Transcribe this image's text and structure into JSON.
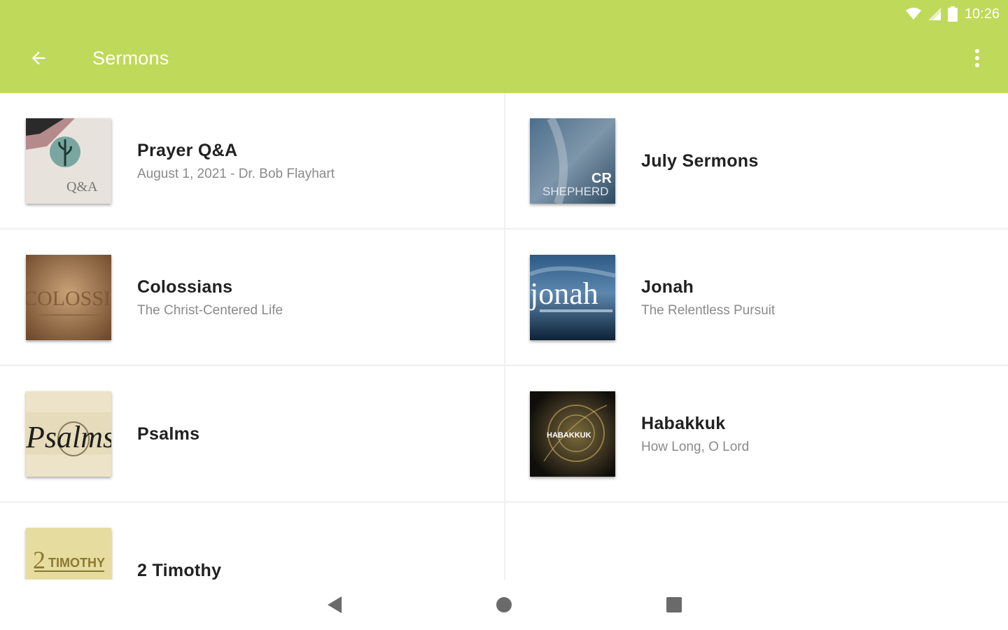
{
  "status_bar": {
    "time": "10:26",
    "icons": [
      "wifi-icon",
      "signal-icon",
      "battery-icon"
    ]
  },
  "app_bar": {
    "title": "Sermons",
    "back_icon": "arrow-left-icon",
    "more_icon": "more-vertical-icon",
    "color": "#bfd95a"
  },
  "series": [
    {
      "title": "Prayer Q&A",
      "subtitle": "August 1, 2021 - Dr. Bob Flayhart",
      "thumb_text": "Q&A"
    },
    {
      "title": "July Sermons",
      "subtitle": "",
      "thumb_text": "CR",
      "thumb_text2": "SHEPHERD"
    },
    {
      "title": "Colossians",
      "subtitle": "The Christ-Centered Life",
      "thumb_text": "COLOSSIANS"
    },
    {
      "title": "Jonah",
      "subtitle": "The Relentless Pursuit",
      "thumb_text": "jonah"
    },
    {
      "title": "Psalms",
      "subtitle": "",
      "thumb_text": "Psalms"
    },
    {
      "title": "Habakkuk",
      "subtitle": "How Long, O Lord",
      "thumb_text": "HABAKKUK"
    },
    {
      "title": "2 Timothy",
      "subtitle": "",
      "thumb_text": "TIMOTHY",
      "thumb_num": "2"
    }
  ],
  "nav_bar": {
    "icons": [
      "back-triangle-icon",
      "home-circle-icon",
      "recents-square-icon"
    ]
  }
}
